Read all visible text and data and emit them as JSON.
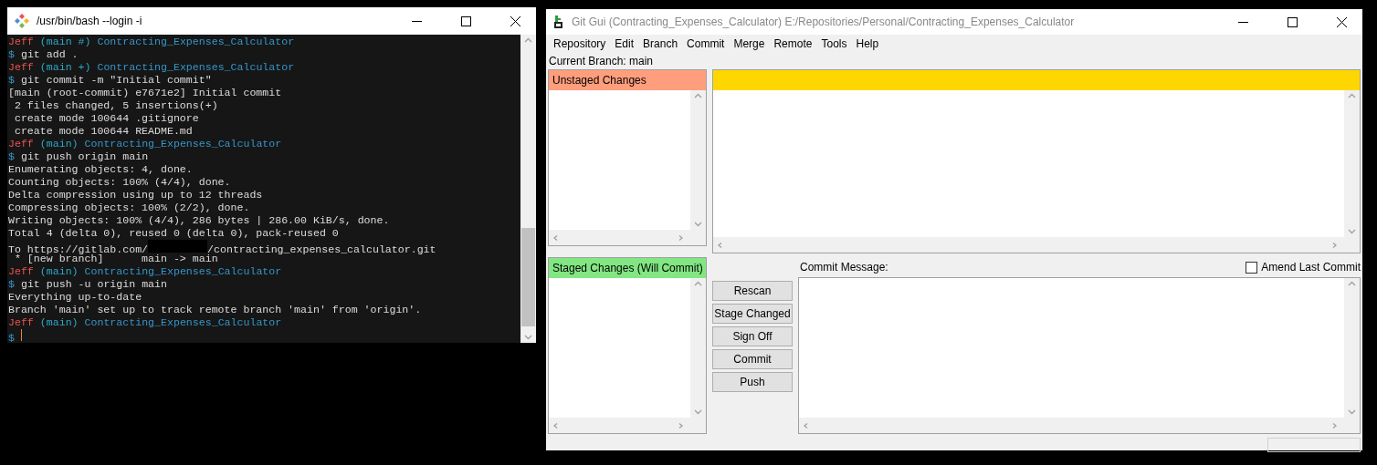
{
  "terminal": {
    "title": "/usr/bin/bash --login -i",
    "lines": [
      {
        "kind": "prompt",
        "user": "Jeff",
        "branch": "(main #)",
        "dir": "Contracting_Expenses_Calculator"
      },
      {
        "kind": "command",
        "prompt": "$",
        "text": "git add ."
      },
      {
        "kind": "prompt",
        "user": "Jeff",
        "branch": "(main +)",
        "dir": "Contracting_Expenses_Calculator"
      },
      {
        "kind": "command",
        "prompt": "$",
        "text": "git commit -m \"Initial commit\""
      },
      {
        "kind": "output",
        "text": "[main (root-commit) e7671e2] Initial commit"
      },
      {
        "kind": "output",
        "text": " 2 files changed, 5 insertions(+)"
      },
      {
        "kind": "output",
        "text": " create mode 100644 .gitignore"
      },
      {
        "kind": "output",
        "text": " create mode 100644 README.md"
      },
      {
        "kind": "prompt",
        "user": "Jeff",
        "branch": "(main)",
        "dir": "Contracting_Expenses_Calculator"
      },
      {
        "kind": "command",
        "prompt": "$",
        "text": "git push origin main"
      },
      {
        "kind": "output",
        "text": "Enumerating objects: 4, done."
      },
      {
        "kind": "output",
        "text": "Counting objects: 100% (4/4), done."
      },
      {
        "kind": "output",
        "text": "Delta compression using up to 12 threads"
      },
      {
        "kind": "output",
        "text": "Compressing objects: 100% (2/2), done."
      },
      {
        "kind": "output",
        "text": "Writing objects: 100% (4/4), 286 bytes | 286.00 KiB/s, done."
      },
      {
        "kind": "output",
        "text": "Total 4 (delta 0), reused 0 (delta 0), pack-reused 0"
      },
      {
        "kind": "redacted",
        "before": "To https://gitlab.com/",
        "after": "/contracting_expenses_calculator.git"
      },
      {
        "kind": "output",
        "text": " * [new branch]      main -> main"
      },
      {
        "kind": "prompt",
        "user": "Jeff",
        "branch": "(main)",
        "dir": "Contracting_Expenses_Calculator"
      },
      {
        "kind": "command",
        "prompt": "$",
        "text": "git push -u origin main"
      },
      {
        "kind": "output",
        "text": "Everything up-to-date"
      },
      {
        "kind": "output",
        "text": "Branch 'main' set up to track remote branch 'main' from 'origin'."
      },
      {
        "kind": "prompt",
        "user": "Jeff",
        "branch": "(main)",
        "dir": "Contracting_Expenses_Calculator"
      },
      {
        "kind": "input",
        "prompt": "$"
      }
    ]
  },
  "git_gui": {
    "title": "Git Gui (Contracting_Expenses_Calculator) E:/Repositories/Personal/Contracting_Expenses_Calculator",
    "menu": [
      "Repository",
      "Edit",
      "Branch",
      "Commit",
      "Merge",
      "Remote",
      "Tools",
      "Help"
    ],
    "current_branch": "Current Branch: main",
    "unstaged_header": "Unstaged Changes",
    "staged_header": "Staged Changes (Will Commit)",
    "commit_message_label": "Commit Message:",
    "amend": {
      "label": "Amend Last Commit",
      "checked": false
    },
    "buttons": [
      "Rescan",
      "Stage Changed",
      "Sign Off",
      "Commit",
      "Push"
    ]
  }
}
